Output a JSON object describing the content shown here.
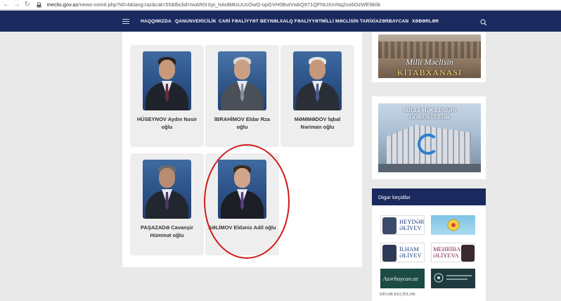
{
  "browser": {
    "url_host": "meclis.gov.az",
    "url_path": "/news-comit.php?id=4&lang=az&cat=55&fbclid=IwAR0rXpi_h4x8MtsUUcOwO-opGVH0ButVwkQ971QFNUXrnNq2vx6OzWE9k0k"
  },
  "nav": {
    "items": [
      "HAQQIMIZDA",
      "QANUNVERİCİLİK",
      "CARİ FƏALİYYƏT",
      "BEYNƏLXALQ FƏALİYYƏT",
      "MİLLİ MƏCLİSİN TARİXİ",
      "AZƏRBAYCAN",
      "XƏBƏRLƏR"
    ]
  },
  "members": [
    {
      "name": "HÜSEYNOV Aydın Nəsir oğlu"
    },
    {
      "name": "İBRAHİMOV Eldar Rza oğlu"
    },
    {
      "name": "MƏMMƏDOV İqbal Nəriman oğlu"
    },
    {
      "name": "PAŞAZADƏ Cavanşir Hümmət oğlu"
    },
    {
      "name": "SƏLİMOV Eldəniz Adil oğlu"
    }
  ],
  "sidebar": {
    "library": {
      "line1": "Milli Məclisin",
      "line2": "KİTABXANASI"
    },
    "gallery": {
      "line1": "MİLLİ MƏCLİSDƏN",
      "line2": "GÖRÜNTÜLƏR"
    },
    "links_title": "Digər keçidlər",
    "links": [
      {
        "label": "HEYDƏR ƏLİYEV"
      },
      {
        "label": ""
      },
      {
        "label": "İLHAM ƏLİYEV"
      },
      {
        "label": "MEHRİBAN ƏLİYEVA"
      },
      {
        "label": "Azərbaycan.az"
      },
      {
        "label": ""
      }
    ],
    "footer": "DİGƏR KEÇİDLƏR"
  },
  "colors": {
    "navbar": "#1b2a5e",
    "highlight": "#d11a1a",
    "page_bg": "#e9e9e9"
  }
}
